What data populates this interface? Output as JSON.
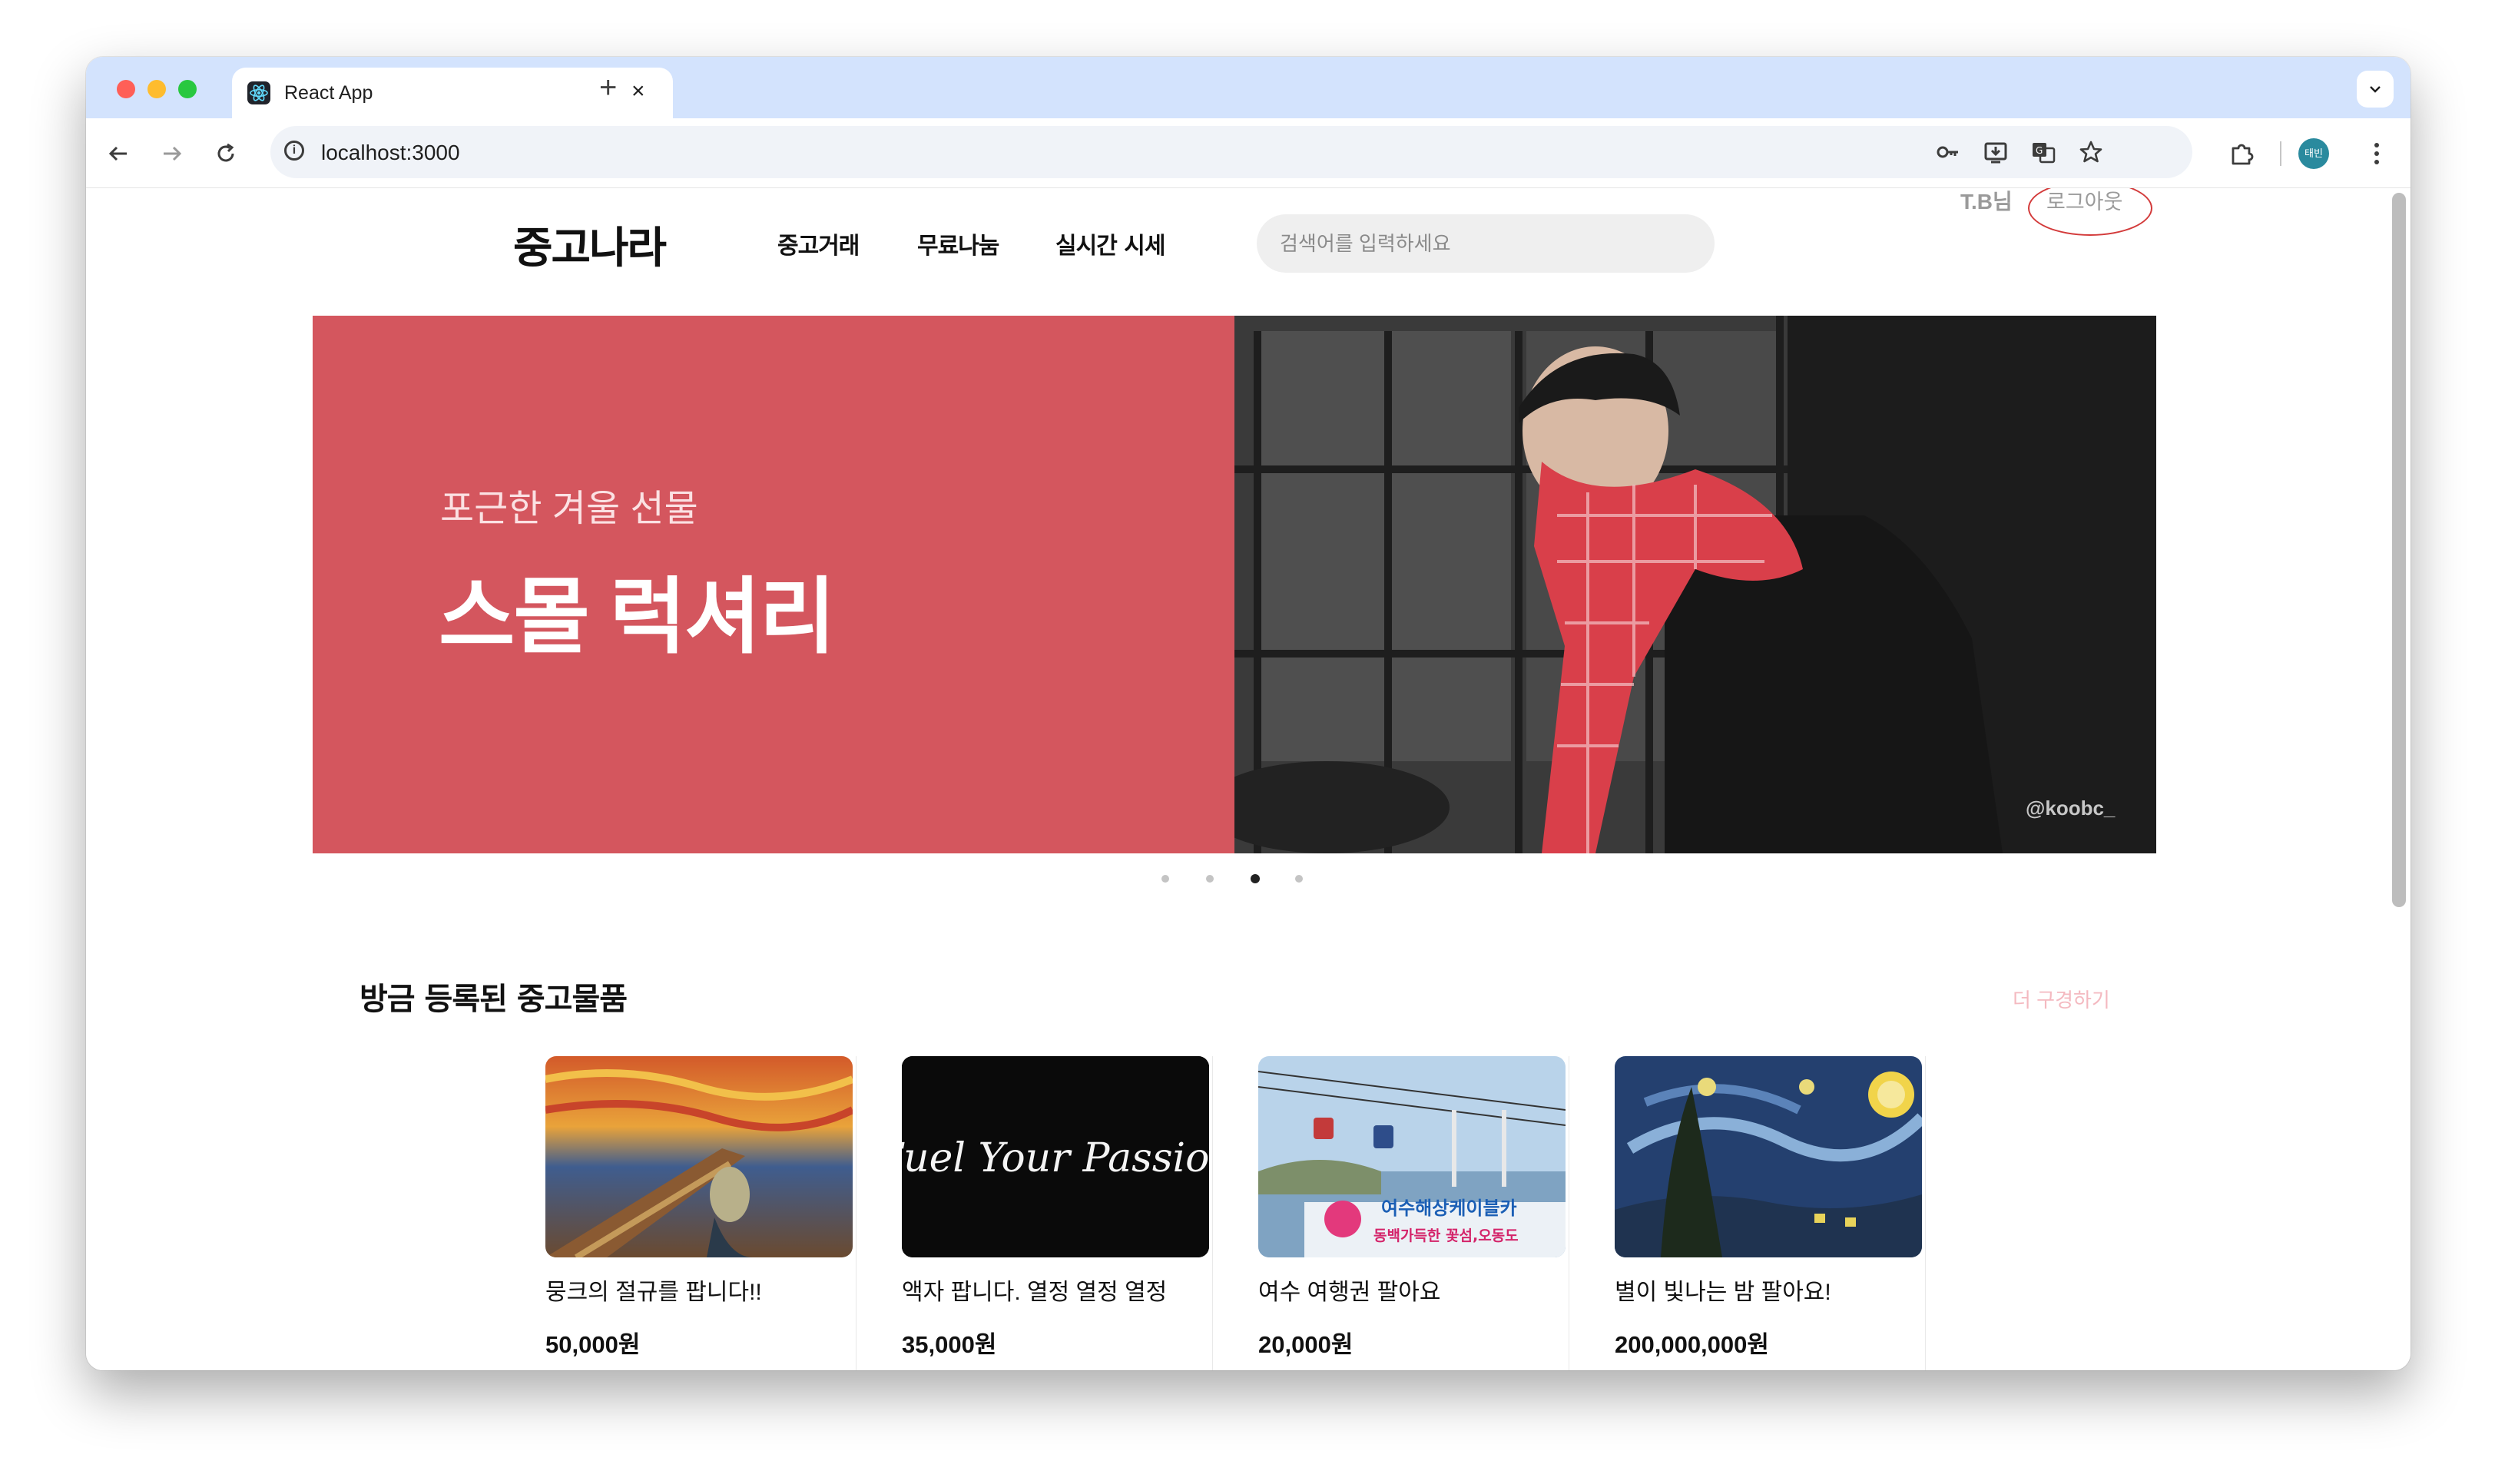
{
  "browser": {
    "tab_title": "React App",
    "tab_close": "×",
    "new_tab": "+",
    "url": "localhost:3000",
    "profile_label": "태빈"
  },
  "header": {
    "logo": "중고나라",
    "menu": [
      "중고거래",
      "무료나눔",
      "실시간 시세"
    ],
    "search_placeholder": "검색어를 입력하세요",
    "user_name": "T.B님",
    "logout_label": "로그아웃"
  },
  "banner": {
    "subtitle": "포근한 겨울 선물",
    "title": "스몰 럭셔리",
    "photo_credit": "@koobc_",
    "slide_count": 4,
    "active_slide": 3
  },
  "section": {
    "title": "방금 등록된 중고물품",
    "more_label": "더 구경하기"
  },
  "products": [
    {
      "title": "뭉크의 절규를 팝니다!!",
      "price": "50,000원",
      "image": "the-scream-painting"
    },
    {
      "title": "액자 팝니다. 열정 열정 열정",
      "price": "35,000원",
      "image": "fuel-your-passion-neon"
    },
    {
      "title": "여수 여행권 팔아요",
      "price": "20,000원",
      "image": "yeosu-cable-car"
    },
    {
      "title": "별이 빛나는 밤 팔아요!",
      "price": "200,000,000원",
      "image": "starry-night-painting"
    }
  ],
  "artwork_text": {
    "neon_sign": "Fuel Your Passion",
    "cable_car_line1": "여수해상케이블카",
    "cable_car_line2": "동백가득한 꽃섬,오동도"
  },
  "colors": {
    "banner_bg": "#d4565e",
    "tabstrip_bg": "#d3e3fd",
    "more_link": "#f4b9c0",
    "highlight_ring": "#d33a3a"
  }
}
